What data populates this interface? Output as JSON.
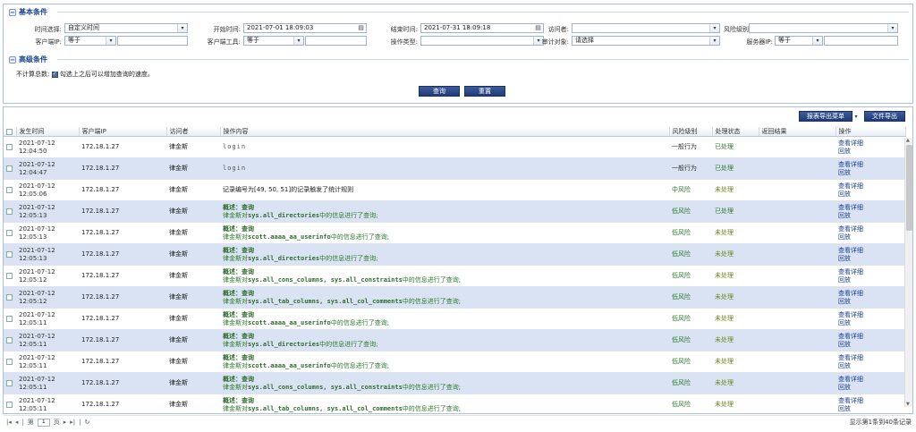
{
  "basic": {
    "title": "基本条件",
    "time_select_label": "时间选择:",
    "time_select_value": "自定义时间",
    "start_label": "开始时间:",
    "start_value": "2021-07-01 18:09:03",
    "end_label": "结束时间:",
    "end_value": "2021-07-31 18:09:18",
    "visitor_label": "访问者:",
    "visitor_value": "",
    "risk_label": "风险级别:",
    "risk_value": "",
    "client_ip_label": "客户端IP:",
    "client_ip_op": "等于",
    "client_tool_label": "客户端工具:",
    "client_tool_op": "等于",
    "op_type_label": "操作类型:",
    "op_type_value": "",
    "audit_label": "审计对象:",
    "audit_value": "请选择",
    "server_ip_label": "服务器IP:",
    "server_ip_op": "等于"
  },
  "advanced": {
    "title": "高级条件",
    "count_label": "不计算总数:",
    "count_hint": "勾选上之后可以增加查询的速度。",
    "query_button": "查询",
    "reset_button": "重置"
  },
  "toolbar": {
    "report_export": "报表导出菜单",
    "file_export": "文件导出"
  },
  "columns": [
    "发生时间",
    "客户端IP",
    "访问者",
    "操作内容",
    "风险级别",
    "处理状态",
    "返回结果",
    "操作"
  ],
  "rows": [
    {
      "date": "2021-07-12",
      "time": "12:04:50",
      "ip": "172.18.1.27",
      "user": "律金斯",
      "kind": "plain",
      "content": "login",
      "risk": "一般行为",
      "status": "已处理"
    },
    {
      "date": "2021-07-12",
      "time": "12:04:47",
      "ip": "172.18.1.27",
      "user": "律金斯",
      "kind": "plain",
      "content": "login",
      "risk": "一般行为",
      "status": "已处理"
    },
    {
      "date": "2021-07-12",
      "time": "12:05:06",
      "ip": "172.18.1.27",
      "user": "律金斯",
      "kind": "text",
      "content": "记录编号为[49, 50, 51]的记录触发了统计规则",
      "risk": "中风险",
      "status": "未处理"
    },
    {
      "date": "2021-07-12",
      "time": "12:05:13",
      "ip": "172.18.1.27",
      "user": "律金斯",
      "kind": "query",
      "summary": "概述：查询",
      "prefix": "律金斯对",
      "object": "sys.all_directories",
      "suffix": "中的信息进行了查询;",
      "risk": "低风险",
      "status": "已处理"
    },
    {
      "date": "2021-07-12",
      "time": "12:05:13",
      "ip": "172.18.1.27",
      "user": "律金斯",
      "kind": "query",
      "summary": "概述：查询",
      "prefix": "律金斯对",
      "object": "scott.aaaa_aa_userinfo",
      "suffix": "中的信息进行了查询;",
      "risk": "低风险",
      "status": "未处理"
    },
    {
      "date": "2021-07-12",
      "time": "12:05:13",
      "ip": "172.18.1.27",
      "user": "律金斯",
      "kind": "query",
      "summary": "概述：查询",
      "prefix": "律金斯对",
      "object": "sys.all_directories",
      "suffix": "中的信息进行了查询;",
      "risk": "低风险",
      "status": "未处理"
    },
    {
      "date": "2021-07-12",
      "time": "12:05:12",
      "ip": "172.18.1.27",
      "user": "律金斯",
      "kind": "query",
      "summary": "概述：查询",
      "prefix": "律金斯对",
      "object": "sys.all_cons_columns, sys.all_constraints",
      "suffix": "中的信息进行了查询;",
      "risk": "低风险",
      "status": "未处理"
    },
    {
      "date": "2021-07-12",
      "time": "12:05:12",
      "ip": "172.18.1.27",
      "user": "律金斯",
      "kind": "query",
      "summary": "概述：查询",
      "prefix": "律金斯对",
      "object": "sys.all_tab_columns, sys.all_col_comments",
      "suffix": "中的信息进行了查询;",
      "risk": "低风险",
      "status": "未处理"
    },
    {
      "date": "2021-07-12",
      "time": "12:05:11",
      "ip": "172.18.1.27",
      "user": "律金斯",
      "kind": "query",
      "summary": "概述：查询",
      "prefix": "律金斯对",
      "object": "scott.aaaa_aa_userinfo",
      "suffix": "中的信息进行了查询;",
      "risk": "低风险",
      "status": "未处理"
    },
    {
      "date": "2021-07-12",
      "time": "12:05:11",
      "ip": "172.18.1.27",
      "user": "律金斯",
      "kind": "query",
      "summary": "概述：查询",
      "prefix": "律金斯对",
      "object": "sys.all_directories",
      "suffix": "中的信息进行了查询;",
      "risk": "低风险",
      "status": "未处理"
    },
    {
      "date": "2021-07-12",
      "time": "12:05:11",
      "ip": "172.18.1.27",
      "user": "律金斯",
      "kind": "query",
      "summary": "概述：查询",
      "prefix": "律金斯对",
      "object": "scott.aaaa_aa_userinfo",
      "suffix": "中的信息进行了查询;",
      "risk": "低风险",
      "status": "未处理"
    },
    {
      "date": "2021-07-12",
      "time": "12:05:11",
      "ip": "172.18.1.27",
      "user": "律金斯",
      "kind": "query",
      "summary": "概述：查询",
      "prefix": "律金斯对",
      "object": "sys.all_cons_columns, sys.all_constraints",
      "suffix": "中的信息进行了查询;",
      "risk": "低风险",
      "status": "未处理"
    },
    {
      "date": "2021-07-12",
      "time": "12:05:11",
      "ip": "172.18.1.27",
      "user": "律金斯",
      "kind": "query",
      "summary": "概述：查询",
      "prefix": "律金斯对",
      "object": "sys.all_tab_columns, sys.all_col_comments",
      "suffix": "中的信息进行了查询;",
      "risk": "低风险",
      "status": "未处理"
    }
  ],
  "row_actions": {
    "detail": "查看详细",
    "replay": "回放"
  },
  "pager": {
    "page_prefix": "第",
    "page_value": "1",
    "page_suffix": "页",
    "info": "显示第1条到40条记录"
  }
}
